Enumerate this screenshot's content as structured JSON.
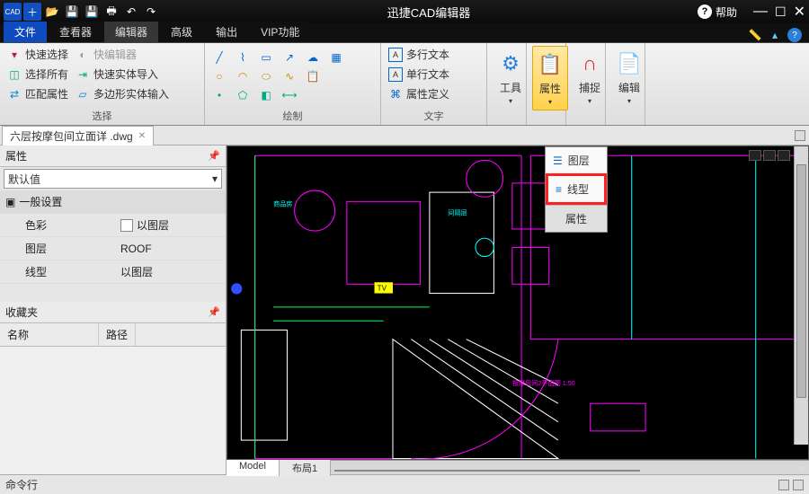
{
  "titlebar": {
    "title": "迅捷CAD编辑器",
    "help": "帮助"
  },
  "tabs": {
    "file": "文件",
    "viewer": "查看器",
    "editor": "编辑器",
    "advanced": "高级",
    "output": "输出",
    "vip": "VIP功能"
  },
  "ribbon": {
    "select_group_label": "选择",
    "quick_select": "快速选择",
    "quick_editor": "快编辑器",
    "select_all": "选择所有",
    "import_solid": "快速实体导入",
    "match_prop": "匹配属性",
    "poly_solid": "多边形实体输入",
    "draw_group_label": "绘制",
    "text_group_label": "文字",
    "mtext": "多行文本",
    "stext": "单行文本",
    "attdef": "属性定义",
    "tools": "工具",
    "props": "属性",
    "capture": "捕捉",
    "edit": "编辑"
  },
  "dropdown": {
    "layer": "图层",
    "linetype": "线型",
    "footer": "属性"
  },
  "doc": {
    "name": "六层按摩包间立面详 .dwg"
  },
  "properties": {
    "panel_title": "属性",
    "default_value": "默认值",
    "general_cat": "一般设置",
    "color_label": "色彩",
    "color_value": "以图层",
    "layer_label": "图层",
    "layer_value": "ROOF",
    "linetype_label": "线型",
    "linetype_value": "以图层"
  },
  "favorites": {
    "title": "收藏夹",
    "col_name": "名称",
    "col_path": "路径"
  },
  "layout": {
    "model": "Model",
    "layout1": "布局1"
  },
  "canvas_text": {
    "note1": "按摩包间2平面图 1:50"
  },
  "cmdline": {
    "label": "命令行"
  }
}
